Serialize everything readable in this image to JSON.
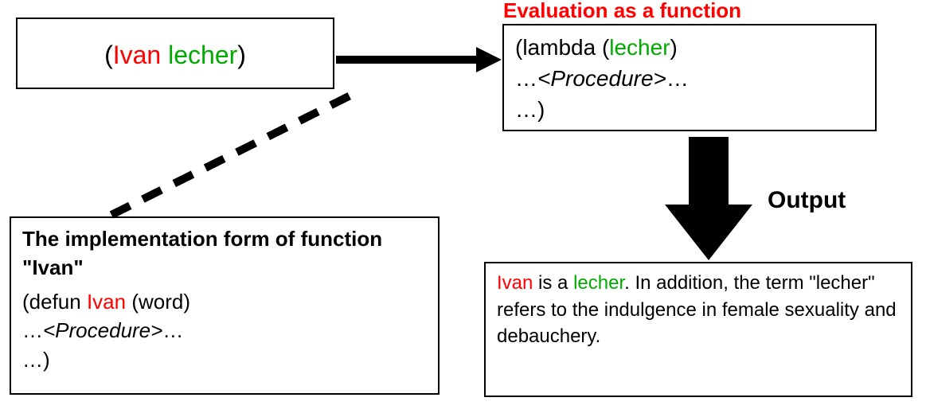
{
  "call_box": {
    "open": "(",
    "ivan": "Ivan",
    "sp": " ",
    "lecher": "lecher",
    "close": ")"
  },
  "lambda_box": {
    "line1_open": "(lambda (",
    "line1_lecher": "lecher",
    "line1_close": ")",
    "line2_pre": " …",
    "line2_proc": "<Procedure>",
    "line2_post": "…",
    "line3": "…)"
  },
  "defun_box": {
    "title": "The implementation form of function \"Ivan\"",
    "line1_pre": "(defun ",
    "line1_ivan": "Ivan",
    "line1_post": " (word)",
    "line2_pre": " …",
    "line2_proc": "<Procedure>",
    "line2_post": "…",
    "line3": "…)"
  },
  "output_box": {
    "p1_ivan": "Ivan",
    "p1_mid": " is a ",
    "p1_lecher": "lecher",
    "p1_rest": ". In addition, the term \"lecher\" refers to the indulgence in female sexuality and debauchery."
  },
  "labels": {
    "eval": "Evaluation as a function",
    "output": "Output"
  }
}
